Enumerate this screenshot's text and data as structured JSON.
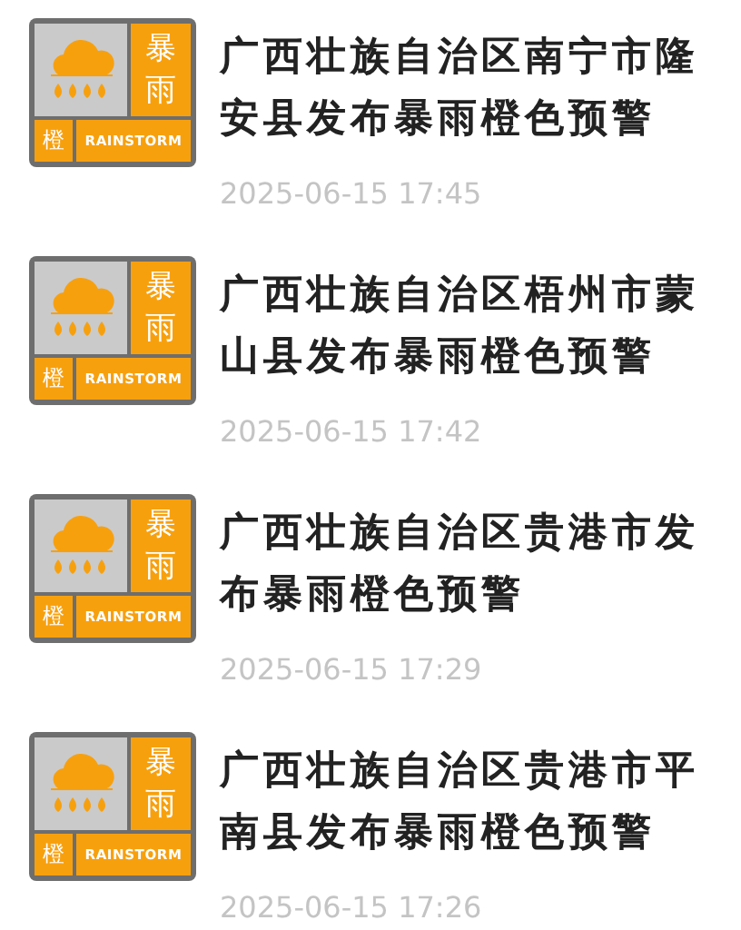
{
  "alerts": [
    {
      "badge": {
        "type": "暴雨",
        "level": "橙",
        "english": "RAINSTORM"
      },
      "title": "广西壮族自治区南宁市隆安县发布暴雨橙色预警",
      "time": "2025-06-15 17:45"
    },
    {
      "badge": {
        "type": "暴雨",
        "level": "橙",
        "english": "RAINSTORM"
      },
      "title": "广西壮族自治区梧州市蒙山县发布暴雨橙色预警",
      "time": "2025-06-15 17:42"
    },
    {
      "badge": {
        "type": "暴雨",
        "level": "橙",
        "english": "RAINSTORM"
      },
      "title": "广西壮族自治区贵港市发布暴雨橙色预警",
      "time": "2025-06-15 17:29"
    },
    {
      "badge": {
        "type": "暴雨",
        "level": "橙",
        "english": "RAINSTORM"
      },
      "title": "广西壮族自治区贵港市平南县发布暴雨橙色预警",
      "time": "2025-06-15 17:26"
    }
  ]
}
